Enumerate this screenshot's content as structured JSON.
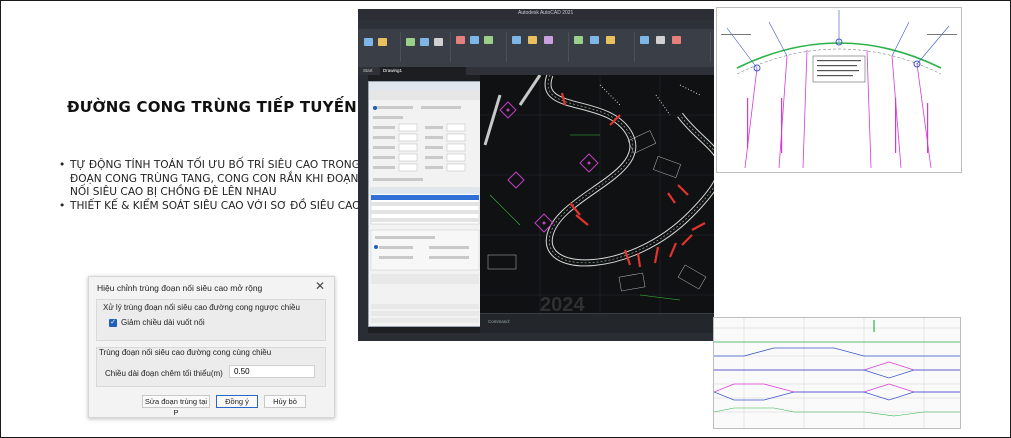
{
  "slide": {
    "title": "ĐƯỜNG CONG TRÙNG TIẾP TUYẾN",
    "bullets": [
      "TỰ ĐỘNG TÍNH TOÁN TỐI ƯU BỐ TRÍ SIÊU CAO TRONG ĐOẠN CONG TRÙNG TANG, CONG CON RẮN KHI ĐOẠN NỐI SIÊU CAO BỊ CHỒNG ĐÈ LÊN NHAU",
      "THIẾT KẾ & KIỂM SOÁT SIÊU CAO VỚI SƠ ĐỒ SIÊU CAO"
    ]
  },
  "dialog": {
    "title": "Hiệu chỉnh trùng đoạn nối siêu cao mở rộng",
    "close_symbol": "✕",
    "group1_title": "Xử lý trùng đoạn nối siêu cao đường cong ngược chiều",
    "checkbox_label": "Giảm chiều dài vuốt nối",
    "checkbox_checked": true,
    "group2_title": "Trùng đoạn nối siêu cao đường cong cùng chiều",
    "field_label": "Chiều dài đoạn chêm tối thiểu(m)",
    "field_value": "0.50",
    "btn_fix": "Sửa đoạn trùng tại P",
    "btn_ok": "Đồng ý",
    "btn_cancel": "Hủy bỏ"
  },
  "cad": {
    "title": "Autodesk AutoCAD 2021",
    "tabs": [
      "Start",
      "Drawing1",
      "",
      ""
    ],
    "command_text": "Command:",
    "watermark": "2024",
    "colors": {
      "road": "#d8d8d8",
      "marker": "#e0342d",
      "sign": "#c23fbf",
      "dim": "#3cc23c"
    }
  },
  "colors": {
    "checkbox": "#1f5fb8",
    "ok_border": "#2a66c5",
    "profile_magenta": "#d63ad6",
    "profile_blue": "#3a57c8",
    "profile_green": "#2bb34a"
  }
}
